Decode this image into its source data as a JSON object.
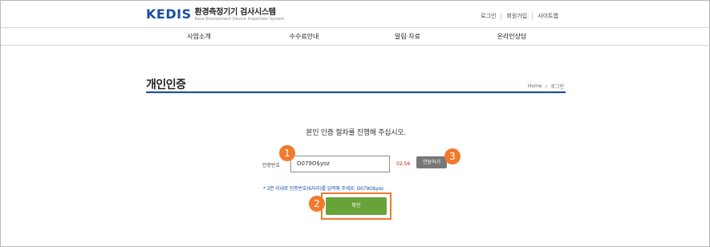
{
  "header": {
    "logo_mark": "KEDIS",
    "logo_kor": "환경측정기기 검사시스템",
    "logo_eng": "Kace Environment Device Inspection System",
    "util_links": [
      "로그인",
      "회원가입",
      "사이트맵"
    ]
  },
  "gnb": {
    "items": [
      "사업소개",
      "수수료안내",
      "알림·자료",
      "온라인상담"
    ]
  },
  "page": {
    "title": "개인인증",
    "breadcrumb_home": "Home",
    "breadcrumb_current": "로그인",
    "guide": "본인 인증 절차를 진행해 주십시오."
  },
  "auth": {
    "label": "인증번호",
    "input_value": "O079O$yoz",
    "timer": "02:56",
    "extend_label": "연장하기",
    "notice": "* 3분 이내로 인증번호(6자리)를 입력해 주세요. O079O$yoz",
    "confirm_label": "확인"
  },
  "callouts": [
    "1",
    "2",
    "3"
  ],
  "colors": {
    "brand": "#1b4ea0",
    "callout": "#f07a2d",
    "confirm": "#6aa23a",
    "timer": "#c61a1a"
  }
}
